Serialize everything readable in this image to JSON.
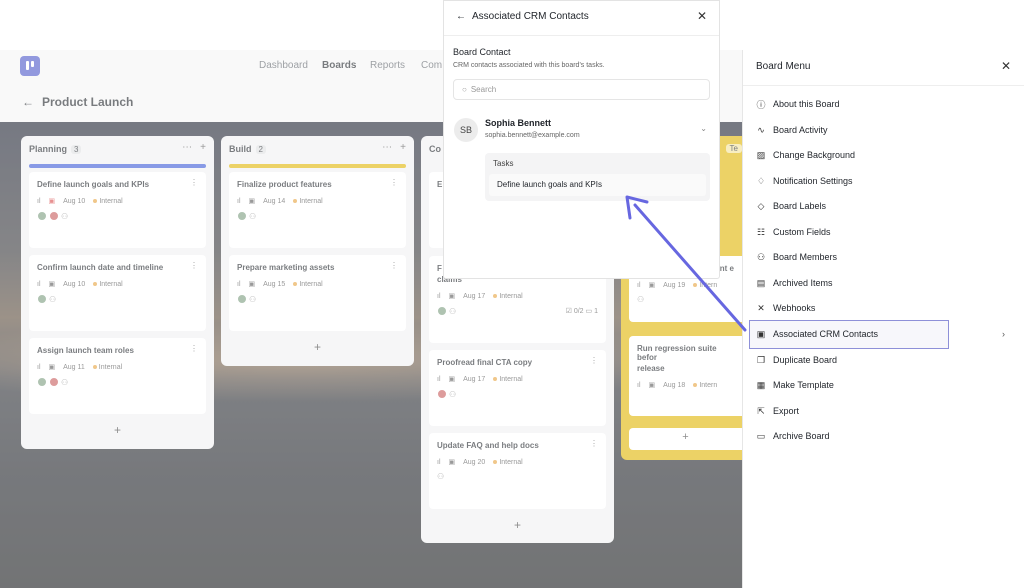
{
  "nav": {
    "items": [
      "Dashboard",
      "Boards",
      "Reports",
      "Com"
    ],
    "active": "Boards"
  },
  "page": {
    "title": "Product Launch"
  },
  "columns": [
    {
      "name": "Planning",
      "count": "3",
      "bar_color": "#3a57d6",
      "cards": [
        {
          "title": "Define launch goals and KPIs",
          "date": "Aug 10",
          "tag": "Internal"
        },
        {
          "title": "Confirm launch date and timeline",
          "date": "Aug 10",
          "tag": "Internal"
        },
        {
          "title": "Assign launch team roles",
          "date": "Aug 11",
          "tag": "Internal"
        }
      ]
    },
    {
      "name": "Build",
      "count": "2",
      "bar_color": "#e0b400",
      "cards": [
        {
          "title": "Finalize product features",
          "date": "Aug 14",
          "tag": "Internal"
        },
        {
          "title": "Prepare marketing assets",
          "date": "Aug 15",
          "tag": "Internal"
        }
      ]
    },
    {
      "name": "Co",
      "cards": [
        {
          "title_fragment": "E"
        },
        {
          "title_fragment": "F",
          "title2": "claims",
          "date": "Aug 17",
          "tag": "Internal",
          "checklist": "0/2",
          "comments": "1"
        },
        {
          "title": "Proofread final CTA copy",
          "date": "Aug 17",
          "tag": "Internal"
        },
        {
          "title": "Update FAQ and help docs",
          "date": "Aug 20",
          "tag": "Internal"
        }
      ]
    },
    {
      "name_fragment": "Te",
      "cards": [
        {
          "title_fragment": "ent e",
          "date": "Aug 19",
          "tag": "Intern"
        },
        {
          "title": "Run regression suite befor",
          "title2": "release",
          "date": "Aug 18",
          "tag": "Intern"
        }
      ]
    }
  ],
  "modal": {
    "title": "Associated CRM Contacts",
    "section": "Board Contact",
    "description": "CRM contacts associated with this board's tasks.",
    "search_placeholder": "Search",
    "contact": {
      "initials": "SB",
      "name": "Sophia Bennett",
      "email": "sophia.bennett@example.com"
    },
    "tasks_label": "Tasks",
    "task": "Define launch goals and KPIs"
  },
  "board_menu": {
    "title": "Board Menu",
    "items": [
      {
        "label": "About this Board",
        "icon": "info-icon"
      },
      {
        "label": "Board Activity",
        "icon": "activity-icon"
      },
      {
        "label": "Change Background",
        "icon": "image-icon"
      },
      {
        "label": "Notification Settings",
        "icon": "bell-icon"
      },
      {
        "label": "Board Labels",
        "icon": "tag-icon"
      },
      {
        "label": "Custom Fields",
        "icon": "fields-icon"
      },
      {
        "label": "Board Members",
        "icon": "users-icon"
      },
      {
        "label": "Archived Items",
        "icon": "archive-icon"
      },
      {
        "label": "Webhooks",
        "icon": "webhook-icon"
      },
      {
        "label": "Associated CRM Contacts",
        "icon": "contacts-icon",
        "selected": true
      },
      {
        "label": "Duplicate Board",
        "icon": "copy-icon"
      },
      {
        "label": "Make Template",
        "icon": "template-icon"
      },
      {
        "label": "Export",
        "icon": "export-icon"
      },
      {
        "label": "Archive Board",
        "icon": "archive-box-icon"
      }
    ]
  },
  "colors": {
    "accent": "#5b5fd6",
    "highlight_border": "#8e90d8"
  }
}
